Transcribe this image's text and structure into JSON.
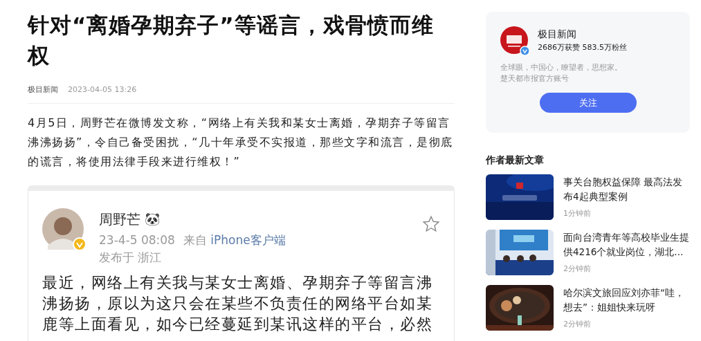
{
  "article": {
    "title": "针对“离婚孕期弃子”等谣言，戏骨愤而维权",
    "source": "极目新闻",
    "time": "2023-04-05 13:26",
    "paragraph": "4月5日，周野芒在微博发文称，“网络上有关我和某女士离婚，孕期弃子等留言沸沸扬扬”，令自己备受困扰，“几十年承受不实报道，那些文字和流言，是彻底的谎言，将使用法律手段来进行维权！”"
  },
  "post_screenshot": {
    "name": "周野芒",
    "emoji": "🐼",
    "date": "23-4-5 08:08",
    "source_prefix": "来自",
    "source": "iPhone客户端",
    "location": "发布于 浙江",
    "verified": true,
    "favorited": false,
    "lines": [
      "最近，网络上有关我与某女士离婚、孕期弃子等留言沸",
      "沸扬扬，原以为这只会在某些不负责任的网络平台如某",
      "鹿等上面看见，如今已经蔓延到某讯这样的平台，必然"
    ]
  },
  "author_card": {
    "name": "极目新闻",
    "stats": "2686万获赞 583.5万粉丝",
    "verified": true,
    "bio": [
      "全球眼，中国心，瞭望者，思想家。",
      "楚天都市报官方账号"
    ],
    "follow_button": "关注"
  },
  "latest": {
    "heading": "作者最新文章",
    "items": [
      {
        "title": "事关台胞权益保障 最高法发布4起典型案例",
        "time": "1分钟前"
      },
      {
        "title": "面向台湾青年等高校毕业生提供4216个就业岗位，湖北...",
        "time": "2分钟前"
      },
      {
        "title": "哈尔滨文旅回应刘亦菲“哇，想去”：姐姐快来玩呀",
        "time": "2分钟前"
      }
    ]
  }
}
